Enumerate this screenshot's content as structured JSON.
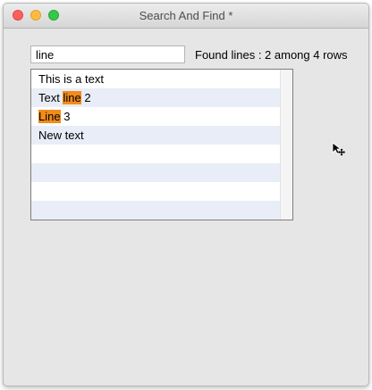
{
  "window": {
    "title": "Search And Find *"
  },
  "search": {
    "value": "line",
    "placeholder": ""
  },
  "status": {
    "text": "Found lines : 2 among 4 rows"
  },
  "list": {
    "rows": [
      {
        "before": "This is a text",
        "match": "",
        "after": ""
      },
      {
        "before": "Text ",
        "match": "line",
        "after": " 2"
      },
      {
        "before": "",
        "match": "Line",
        "after": " 3"
      },
      {
        "before": "New text",
        "match": "",
        "after": ""
      }
    ],
    "empty_row_count": 4
  },
  "colors": {
    "highlight": "#f18b1a",
    "row_alt": "#e8edf7",
    "window_bg": "#e6e6e6"
  },
  "icons": {
    "cursor": "move-cursor-icon"
  }
}
